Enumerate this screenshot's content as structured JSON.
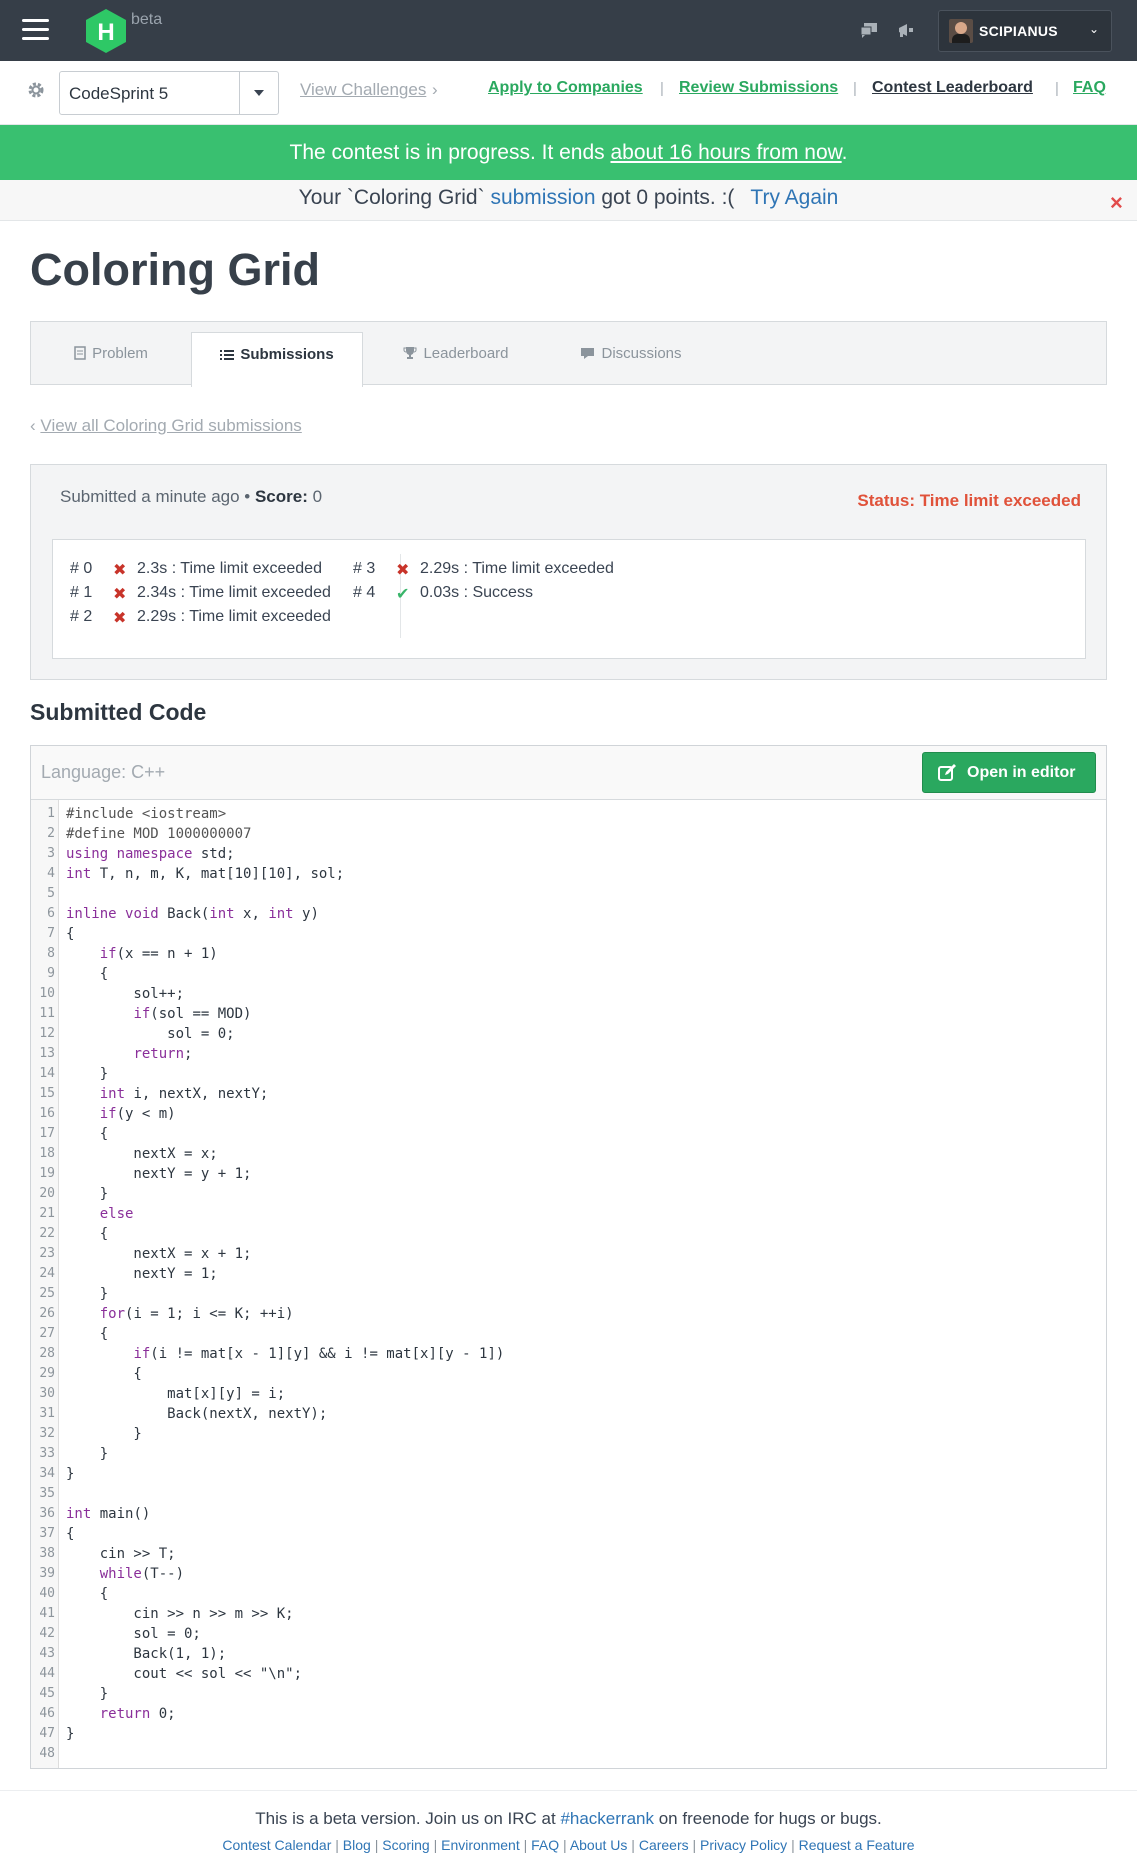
{
  "nav": {
    "beta": "beta",
    "username": "SCIPIANUS",
    "contest": "CodeSprint 5",
    "view_challenges": "View Challenges",
    "apply": "Apply to Companies",
    "review": "Review Submissions",
    "leaderboard": "Contest Leaderboard",
    "faq": "FAQ"
  },
  "banner": {
    "prefix": "The contest is in progress. It ends ",
    "link": "about 16 hours from now",
    "suffix": "."
  },
  "notice": {
    "prefix": "Your `Coloring Grid` ",
    "link": "submission",
    "middle": " got 0 points. :(",
    "try_again": "Try Again"
  },
  "title": "Coloring Grid",
  "tabs": {
    "problem": "Problem",
    "submissions": "Submissions",
    "leaderboard": "Leaderboard",
    "discussions": "Discussions"
  },
  "back_link": "View all Coloring Grid submissions",
  "submission": {
    "submitted": "Submitted a minute ago • ",
    "score_label": "Score:",
    "score": "0",
    "status": "Status: Time limit exceeded",
    "tests_left": [
      {
        "num": "# 0",
        "result": "fail",
        "text": "2.3s : Time limit exceeded"
      },
      {
        "num": "# 1",
        "result": "fail",
        "text": "2.34s : Time limit exceeded"
      },
      {
        "num": "# 2",
        "result": "fail",
        "text": "2.29s : Time limit exceeded"
      }
    ],
    "tests_right": [
      {
        "num": "# 3",
        "result": "fail",
        "text": "2.29s : Time limit exceeded"
      },
      {
        "num": "# 4",
        "result": "ok",
        "text": "0.03s : Success"
      }
    ]
  },
  "code_section": {
    "title": "Submitted Code",
    "language": "Language: C++",
    "open_editor": "Open in editor",
    "lines": [
      "#include <iostream>",
      "#define MOD 1000000007",
      "using namespace std;",
      "int T, n, m, K, mat[10][10], sol;",
      "",
      "inline void Back(int x, int y)",
      "{",
      "    if(x == n + 1)",
      "    {",
      "        sol++;",
      "        if(sol == MOD)",
      "            sol = 0;",
      "        return;",
      "    }",
      "    int i, nextX, nextY;",
      "    if(y < m)",
      "    {",
      "        nextX = x;",
      "        nextY = y + 1;",
      "    }",
      "    else",
      "    {",
      "        nextX = x + 1;",
      "        nextY = 1;",
      "    }",
      "    for(i = 1; i <= K; ++i)",
      "    {",
      "        if(i != mat[x - 1][y] && i != mat[x][y - 1])",
      "        {",
      "            mat[x][y] = i;",
      "            Back(nextX, nextY);",
      "        }",
      "    }",
      "}",
      "",
      "int main()",
      "{",
      "    cin >> T;",
      "    while(T--)",
      "    {",
      "        cin >> n >> m >> K;",
      "        sol = 0;",
      "        Back(1, 1);",
      "        cout << sol << \"\\n\";",
      "    }",
      "    return 0;",
      "}",
      ""
    ]
  },
  "footer": {
    "msg_prefix": "This is a beta version. Join us on IRC at ",
    "msg_link": "#hackerrank",
    "msg_suffix": " on freenode for hugs or bugs.",
    "links": [
      "Contest Calendar",
      "Blog",
      "Scoring",
      "Environment",
      "FAQ",
      "About Us",
      "Careers",
      "Privacy Policy",
      "Request a Feature"
    ]
  },
  "colors": {
    "brand_green": "#39c070",
    "nav_dark": "#363e48",
    "link_green": "#2aa85f",
    "fail_red": "#c8342a",
    "status_red": "#e0523a"
  }
}
